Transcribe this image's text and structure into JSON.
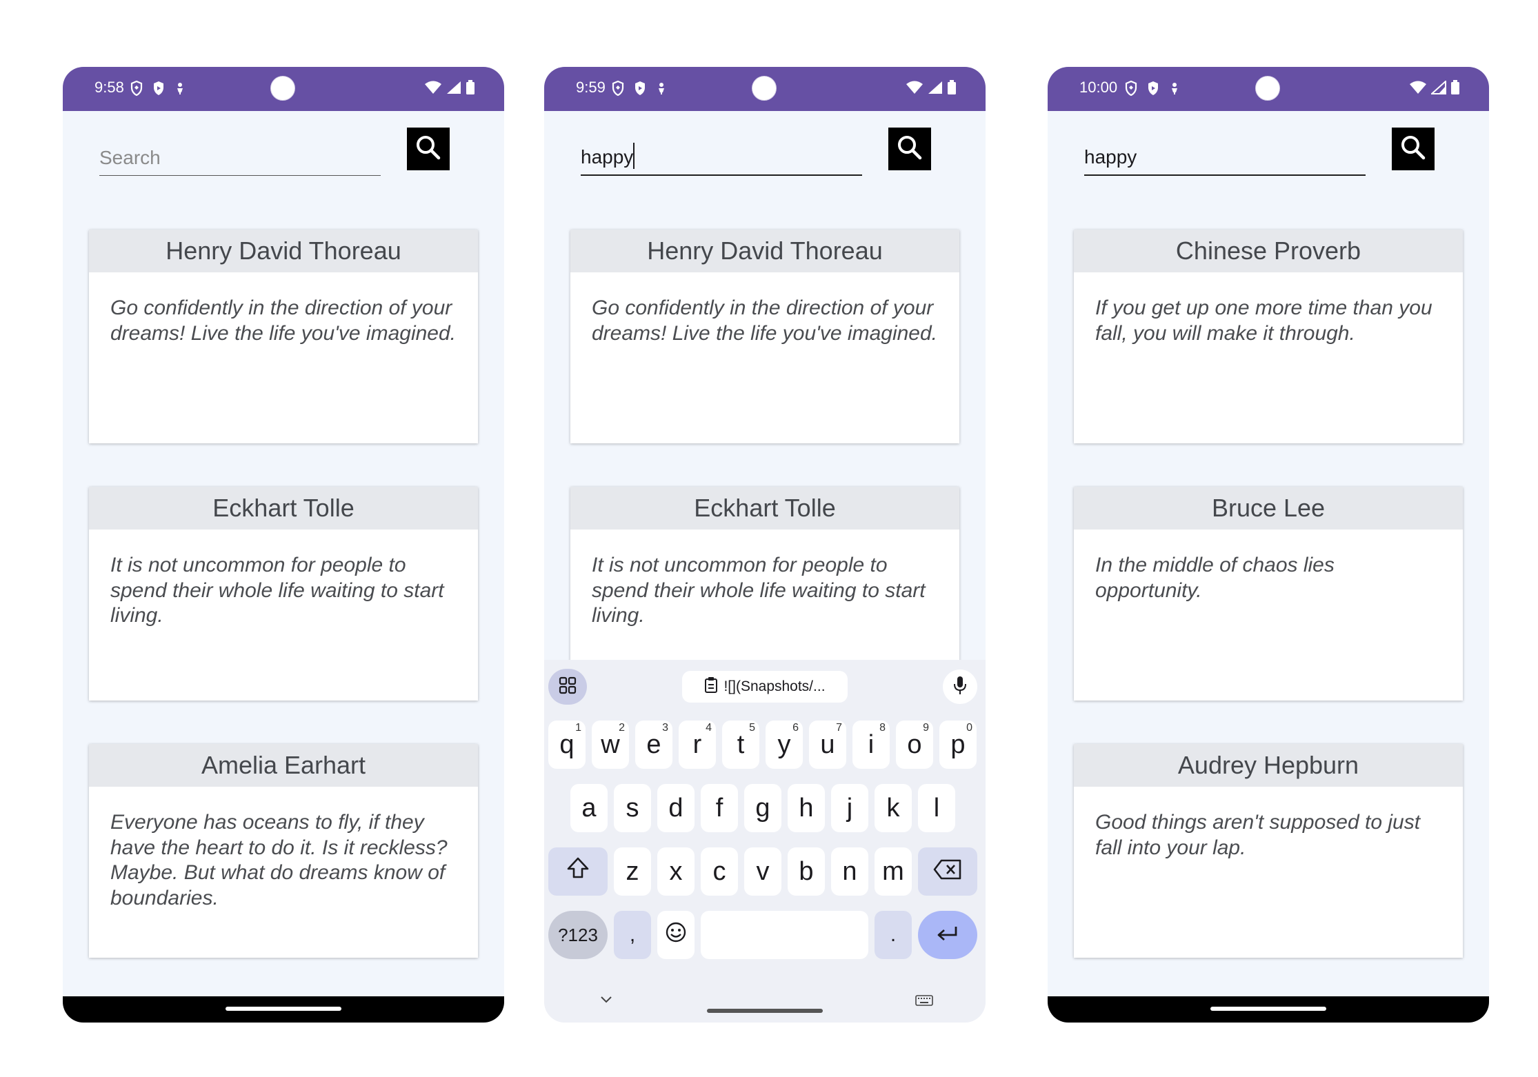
{
  "screens": [
    {
      "time": "9:58",
      "search_value": "",
      "search_placeholder": "Search",
      "cards": [
        {
          "author": "Henry David Thoreau",
          "quote": "Go confidently in the direction of your dreams! Live the life you've imagined."
        },
        {
          "author": "Eckhart Tolle",
          "quote": "It is not uncommon for people to spend their whole life waiting to start living."
        },
        {
          "author": "Amelia Earhart",
          "quote": "Everyone has oceans to fly, if they have the heart to do it. Is it reckless? Maybe. But what do dreams know of boundaries."
        }
      ]
    },
    {
      "time": "9:59",
      "search_value": "happy",
      "search_placeholder": "Search",
      "cards": [
        {
          "author": "Henry David Thoreau",
          "quote": "Go confidently in the direction of your dreams! Live the life you've imagined."
        },
        {
          "author": "Eckhart Tolle",
          "quote": "It is not uncommon for people to spend their whole life waiting to start living."
        }
      ]
    },
    {
      "time": "10:00",
      "search_value": "happy",
      "search_placeholder": "Search",
      "cards": [
        {
          "author": "Chinese Proverb",
          "quote": "If you get up one more time than you fall, you will make it through."
        },
        {
          "author": "Bruce Lee",
          "quote": "In the middle of chaos lies opportunity."
        },
        {
          "author": "Audrey Hepburn",
          "quote": "Good things aren't supposed to just fall into your lap."
        }
      ]
    }
  ],
  "keyboard": {
    "clipboard_text": "![](Snapshots/...",
    "row1": [
      {
        "k": "q",
        "h": "1"
      },
      {
        "k": "w",
        "h": "2"
      },
      {
        "k": "e",
        "h": "3"
      },
      {
        "k": "r",
        "h": "4"
      },
      {
        "k": "t",
        "h": "5"
      },
      {
        "k": "y",
        "h": "6"
      },
      {
        "k": "u",
        "h": "7"
      },
      {
        "k": "i",
        "h": "8"
      },
      {
        "k": "o",
        "h": "9"
      },
      {
        "k": "p",
        "h": "0"
      }
    ],
    "row2": [
      "a",
      "s",
      "d",
      "f",
      "g",
      "h",
      "j",
      "k",
      "l"
    ],
    "row3": [
      "z",
      "x",
      "c",
      "v",
      "b",
      "n",
      "m"
    ],
    "numsym_label": "?123",
    "comma_label": ",",
    "period_label": "."
  },
  "colors": {
    "status_bar": "#6650a4",
    "screen_bg": "#f2f6fc",
    "card_header": "#e6e8ec",
    "enter_key": "#aab7f7"
  },
  "icons": {
    "search_button": "search-icon",
    "status_left": [
      "shield-icon",
      "play-protect-icon",
      "usb-debug-icon"
    ],
    "status_right": [
      "wifi-icon",
      "signal-icon",
      "battery-icon"
    ],
    "keyboard": [
      "apps-grid-icon",
      "clipboard-icon",
      "mic-icon",
      "shift-icon",
      "backspace-icon",
      "emoji-icon",
      "enter-icon",
      "collapse-keyboard-icon",
      "keyboard-switch-icon"
    ]
  }
}
